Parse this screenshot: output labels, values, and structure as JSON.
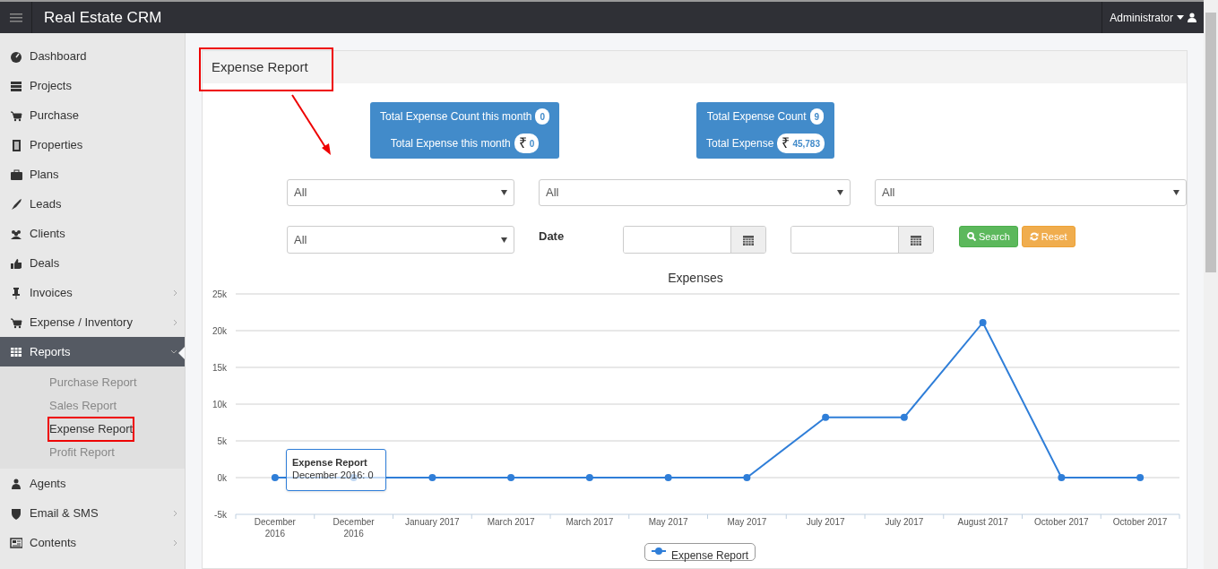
{
  "app": {
    "title": "Real Estate CRM",
    "user": "Administrator"
  },
  "sidebar": {
    "items": [
      {
        "label": "Dashboard",
        "submenu": false,
        "selected": false
      },
      {
        "label": "Projects",
        "submenu": false,
        "selected": false
      },
      {
        "label": "Purchase",
        "submenu": false,
        "selected": false
      },
      {
        "label": "Properties",
        "submenu": false,
        "selected": false
      },
      {
        "label": "Plans",
        "submenu": false,
        "selected": false
      },
      {
        "label": "Leads",
        "submenu": false,
        "selected": false
      },
      {
        "label": "Clients",
        "submenu": false,
        "selected": false
      },
      {
        "label": "Deals",
        "submenu": false,
        "selected": false
      },
      {
        "label": "Invoices",
        "submenu": true,
        "selected": false
      },
      {
        "label": "Expense / Inventory",
        "submenu": true,
        "selected": false
      },
      {
        "label": "Reports",
        "submenu": true,
        "selected": true,
        "expanded": true,
        "children": [
          {
            "label": "Purchase Report",
            "selected": false,
            "highlighted": false
          },
          {
            "label": "Sales Report",
            "selected": false,
            "highlighted": false
          },
          {
            "label": "Expense Report",
            "selected": true,
            "highlighted": true
          },
          {
            "label": "Profit Report",
            "selected": false,
            "highlighted": false
          }
        ]
      },
      {
        "label": "Agents",
        "submenu": false,
        "selected": false
      },
      {
        "label": "Email & SMS",
        "submenu": true,
        "selected": false
      },
      {
        "label": "Contents",
        "submenu": true,
        "selected": false
      }
    ]
  },
  "panel": {
    "title": "Expense Report",
    "highlighted": true,
    "arrow": true,
    "stats": [
      {
        "lines": [
          {
            "label": "Total Expense Count this month",
            "value": "0"
          },
          {
            "label": "Total Expense this month",
            "currency": "₹",
            "value": "0"
          }
        ]
      },
      {
        "lines": [
          {
            "label": "Total Expense Count",
            "value": "9"
          },
          {
            "label": "Total Expense",
            "currency": "₹",
            "value": "45,783"
          }
        ]
      }
    ],
    "filters": {
      "selects": [
        "All",
        "All",
        "All",
        "All"
      ],
      "date_label": "Date",
      "search_button": "Search",
      "reset_button": "Reset"
    },
    "chart": {
      "tooltip": {
        "title": "Expense Report",
        "text": "December 2016: 0"
      },
      "chart_data": {
        "type": "line",
        "title": "Expenses",
        "categories": [
          "December 2016",
          "December 2016",
          "January 2017",
          "March 2017",
          "March 2017",
          "May 2017",
          "May 2017",
          "July 2017",
          "July 2017",
          "August 2017",
          "October 2017",
          "October 2017"
        ],
        "series": [
          {
            "name": "Expense Report",
            "color": "#2f7ed8",
            "values": [
              0,
              0,
              0,
              0,
              0,
              0,
              0,
              8200,
              8200,
              21100,
              0,
              0
            ]
          }
        ],
        "ylim": [
          -5000,
          25000
        ],
        "grid": true,
        "marker": true,
        "yticks": [
          {
            "value": -5000,
            "label": "-5k"
          },
          {
            "value": 0,
            "label": "0k"
          },
          {
            "value": 5000,
            "label": "5k"
          },
          {
            "value": 10000,
            "label": "10k"
          },
          {
            "value": 15000,
            "label": "15k"
          },
          {
            "value": 20000,
            "label": "20k"
          },
          {
            "value": 25000,
            "label": "25k"
          }
        ]
      }
    }
  }
}
